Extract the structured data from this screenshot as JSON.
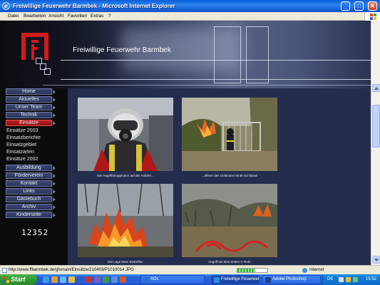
{
  "window": {
    "title": "Freiwillige Feuerwehr Barmbek - Microsoft Internet Explorer",
    "buttons": [
      "_",
      "□",
      "✕"
    ]
  },
  "menu": [
    "Datei",
    "Bearbeiten",
    "Ansicht",
    "Favoriten",
    "Extras",
    "?"
  ],
  "site": {
    "title": "Freiwillige Feuerwehr Barmbek",
    "nav_main": [
      {
        "label": "Home",
        "active": false
      },
      {
        "label": "Aktuelles",
        "active": false
      },
      {
        "label": "Unser Team",
        "active": false
      },
      {
        "label": "Technik",
        "active": false
      },
      {
        "label": "Einsätze",
        "active": true
      }
    ],
    "nav_sub": [
      "Einsätze 2003",
      "Einsatzberichte",
      "Einsatzgebiet",
      "Einsatzarten",
      "Einsätze 2002"
    ],
    "nav_more": [
      "Ausbildung",
      "Förderverein",
      "Kontakt",
      "Links",
      "Gästebuch",
      "Archiv",
      "Kinderseite"
    ],
    "counter": "12352",
    "photos": [
      {
        "caption": "Der Angriffstruppmann auf der Anfahrt...",
        "scene": "firefighter-portrait"
      },
      {
        "caption": "...öffnen des Geländes mit Bi-Schlüssel",
        "scene": "firefighter-gate"
      },
      {
        "caption": "Die Lage beim Eintreffen",
        "scene": "burning-brush"
      },
      {
        "caption": "Angriff mit dem ersten C-Rohr",
        "scene": "hose-field"
      }
    ]
  },
  "status": {
    "url": "http://www.ffbarmbek.de/gfxmain/Einsätze/210403/P1010014.JPG",
    "progress_percent": 60,
    "zone": "Internet"
  },
  "taskbar": {
    "start": "Start",
    "tasks": [
      {
        "label": "AOL",
        "active": false,
        "color": "#2d6fd6"
      },
      {
        "label": "Freiwillige Feuerweh...",
        "active": true,
        "color": "#2a8ce0"
      },
      {
        "label": "Adobe Photoshop",
        "active": false,
        "color": "#1f3f8a"
      }
    ],
    "lang": "DE",
    "clock": "15:52"
  }
}
